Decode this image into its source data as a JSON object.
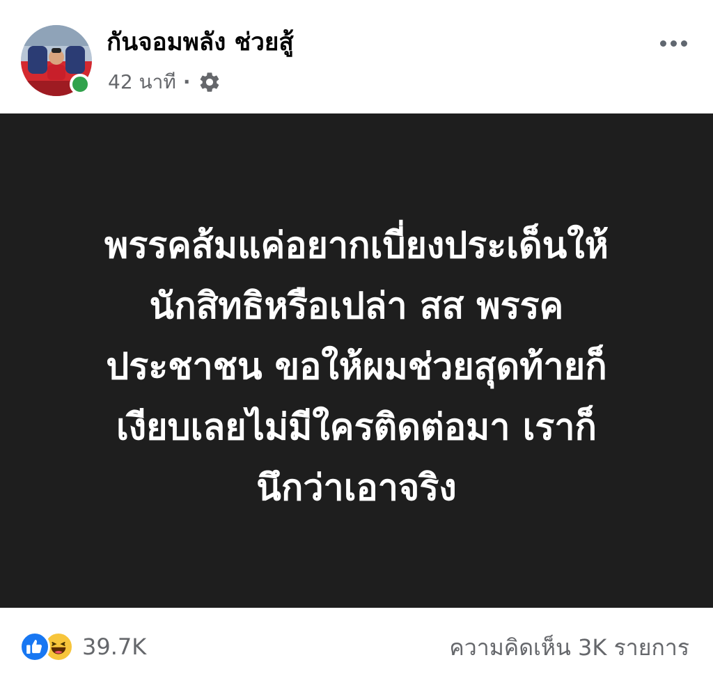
{
  "post": {
    "author_name": "กันจอมพลัง ช่วยสู้",
    "time_ago": "42 นาที",
    "separator": "·",
    "audience_icon": "gear-icon",
    "menu_icon": "more-dots-icon",
    "text_lines": [
      "พรรคส้มแค่อยากเบี่ยงประเด็นให้",
      "นักสิทธิหรือเปล่า สส พรรค",
      "ประชาชน ขอให้ผมช่วยสุดท้ายก็",
      "เงียบเลยไม่มีใครติดต่อมา เราก็",
      "นึกว่าเอาจริง"
    ],
    "background_color": "#1e1e1e"
  },
  "engagement": {
    "reaction_icons": [
      "like-icon",
      "haha-icon"
    ],
    "reaction_count": "39.7K",
    "comments_label": "ความคิดเห็น 3K รายการ"
  },
  "colors": {
    "online": "#31a24c",
    "like": "#1877f2",
    "haha": "#f7c53b",
    "secondary_text": "#65676b"
  }
}
